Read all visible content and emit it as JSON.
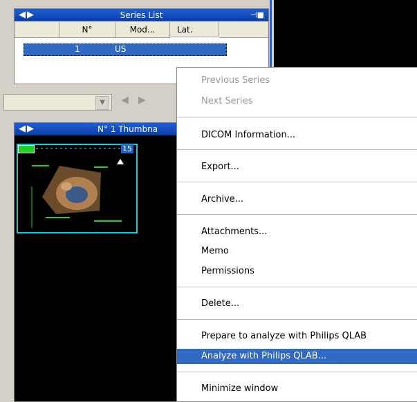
{
  "series_pane": {
    "title": "Series List",
    "columns": [
      "N°",
      "Mod...",
      "Lat."
    ],
    "rows": [
      {
        "number": "1",
        "modality": "US",
        "laterality": ""
      }
    ]
  },
  "thumb_pane": {
    "title": "N° 1 Thumbna",
    "thumbnail_count": "15"
  },
  "context_menu": {
    "items": [
      {
        "label": "Previous Series",
        "disabled": true
      },
      {
        "label": "Next Series",
        "disabled": true
      },
      {
        "label": "DICOM Information..."
      },
      {
        "label": "Export..."
      },
      {
        "label": "Archive..."
      },
      {
        "label": "Attachments..."
      },
      {
        "label": "Memo"
      },
      {
        "label": "Permissions"
      },
      {
        "label": "Delete..."
      },
      {
        "label": "Prepare to analyze with Philips QLAB"
      },
      {
        "label": "Analyze with Philips QLAB...",
        "highlighted": true
      },
      {
        "label": "Minimize window"
      }
    ]
  },
  "colors": {
    "title_bar": "#1f5ed8",
    "selection": "#316ac5",
    "thumb_border": "#1ac9d6"
  }
}
